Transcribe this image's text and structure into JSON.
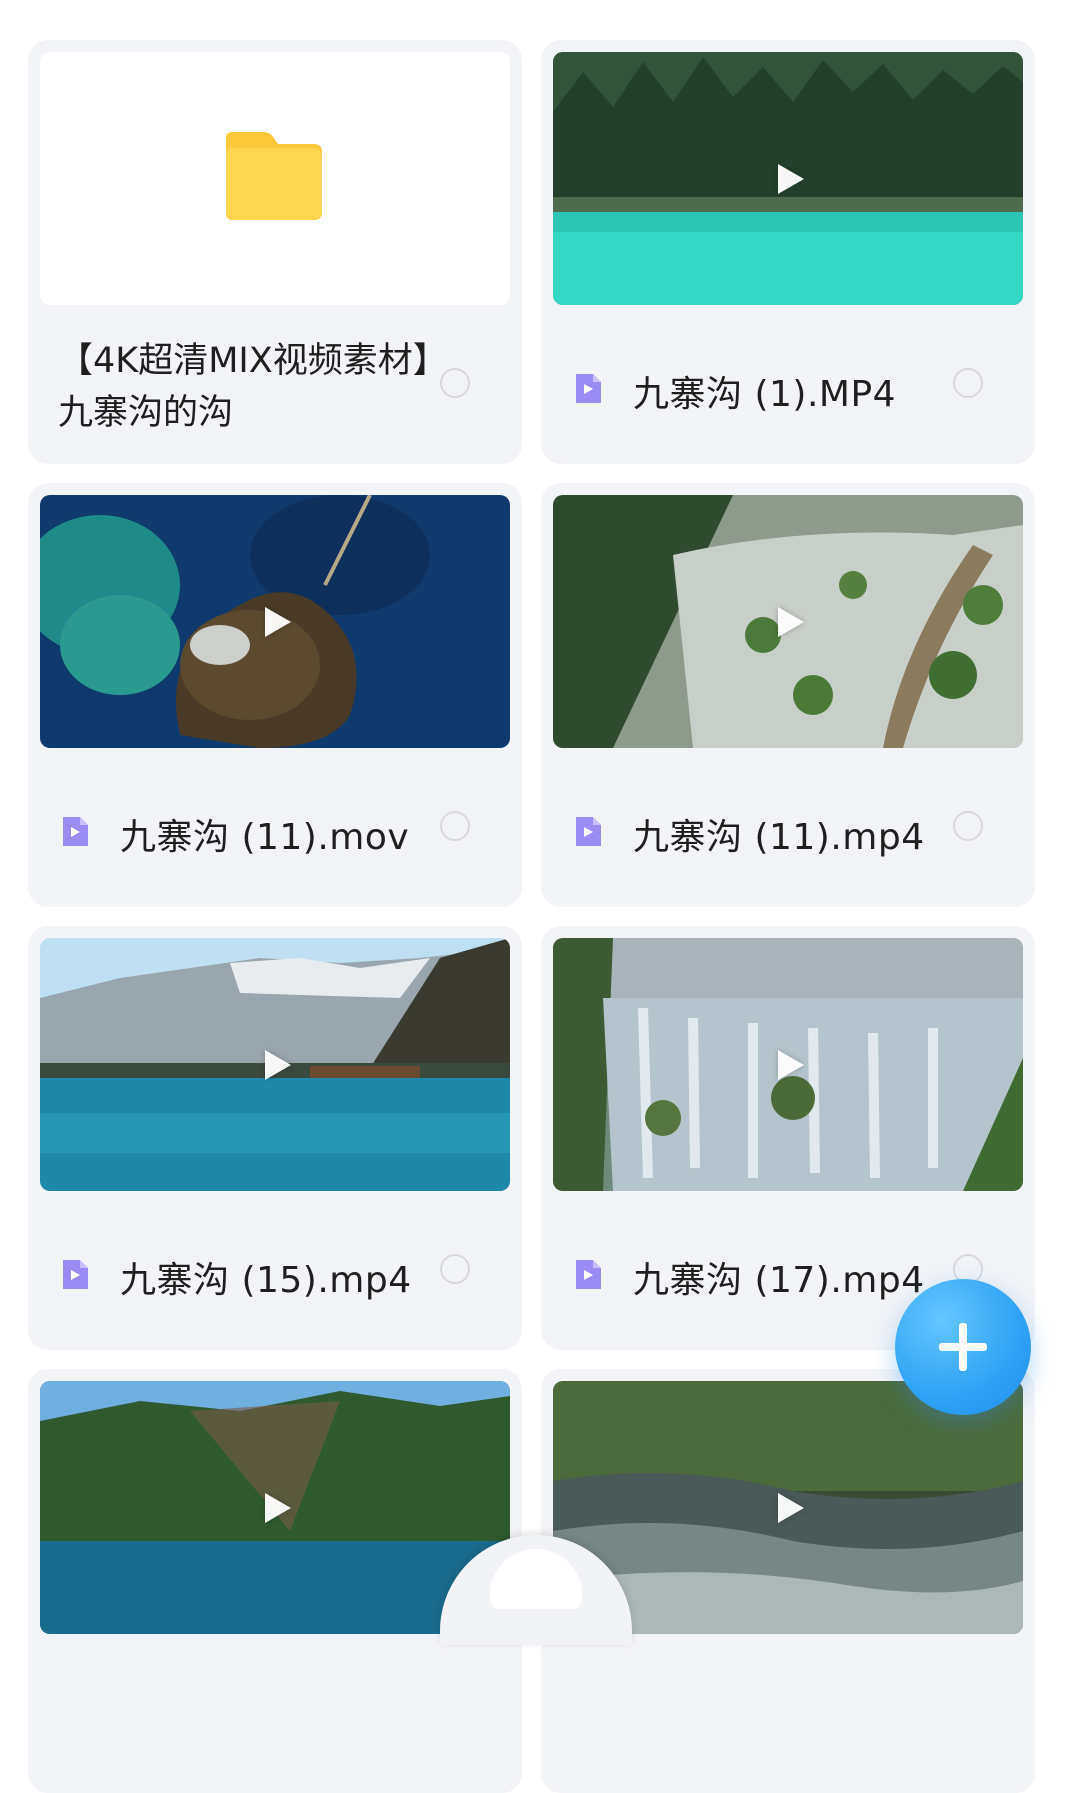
{
  "items": [
    {
      "type": "folder",
      "name": "【4K超清MIX视频素材】九寨沟的沟"
    },
    {
      "type": "video",
      "name": "九寨沟 (1).MP4",
      "thumb_icon": "play-icon"
    },
    {
      "type": "video",
      "name": "九寨沟 (11).mov",
      "thumb_icon": "play-icon"
    },
    {
      "type": "video",
      "name": "九寨沟 (11).mp4",
      "thumb_icon": "play-icon"
    },
    {
      "type": "video",
      "name": "九寨沟 (15).mp4",
      "thumb_icon": "play-icon"
    },
    {
      "type": "video",
      "name": "九寨沟 (17).mp4",
      "thumb_icon": "play-icon"
    },
    {
      "type": "video",
      "name": "",
      "thumb_icon": "play-icon"
    },
    {
      "type": "video",
      "name": "",
      "thumb_icon": "play-icon"
    }
  ],
  "fab": {
    "icon": "plus-icon"
  },
  "colors": {
    "card_bg": "#f3f4f8",
    "video_icon": "#9a8cf2",
    "folder": "#fdd24a",
    "fab": "#2fa2f6"
  }
}
